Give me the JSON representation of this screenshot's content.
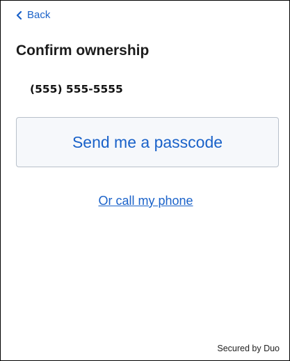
{
  "nav": {
    "back_label": "Back",
    "back_icon": "chevron-left-icon"
  },
  "page": {
    "title": "Confirm ownership",
    "phone_number": "(555) 555-5555"
  },
  "actions": {
    "send_passcode_label": "Send me a passcode",
    "call_phone_label": "Or call my phone"
  },
  "footer": {
    "secured_by": "Secured by Duo"
  },
  "colors": {
    "link": "#1a62c9",
    "button_bg": "#f6f8fb",
    "button_border": "#b8c0ca",
    "text": "#1c1c1c"
  }
}
